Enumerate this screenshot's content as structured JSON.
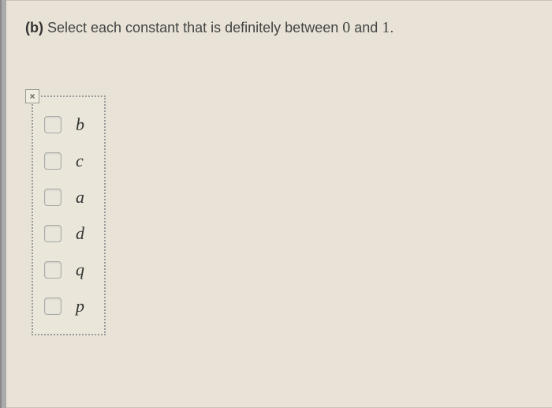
{
  "question": {
    "label": "(b)",
    "text_before": "Select each constant that is definitely between",
    "num1": "0",
    "text_mid": "and",
    "num2": "1",
    "text_after": "."
  },
  "close_icon": "×",
  "options": [
    {
      "label": "b"
    },
    {
      "label": "c"
    },
    {
      "label": "a"
    },
    {
      "label": "d"
    },
    {
      "label": "q"
    },
    {
      "label": "p"
    }
  ]
}
